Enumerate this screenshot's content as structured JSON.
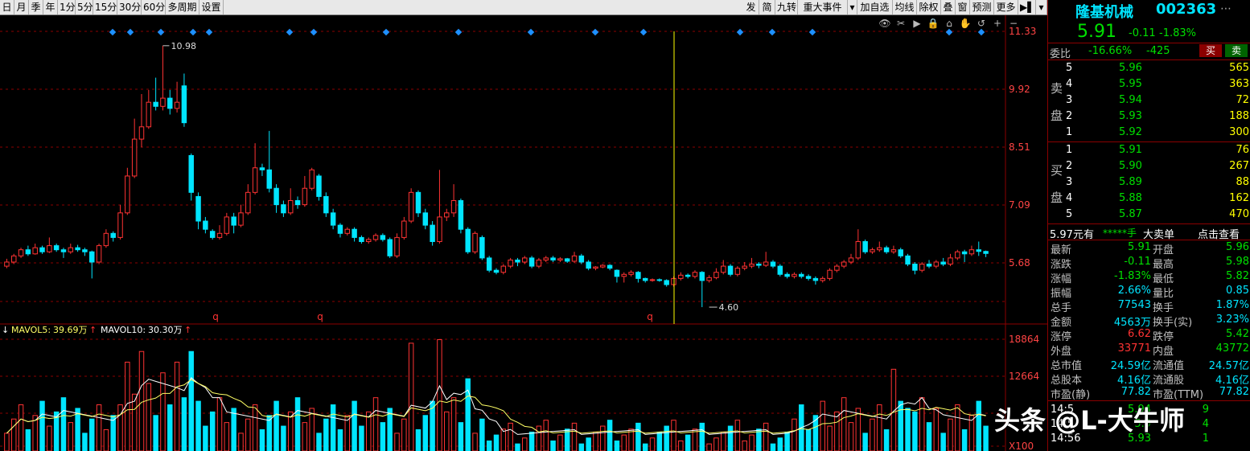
{
  "toolbar": {
    "left_items": [
      "日",
      "月",
      "季",
      "年",
      "1分",
      "5分",
      "15分",
      "30分",
      "60分",
      "多周期",
      "设置"
    ],
    "right_items": [
      "发",
      "简",
      "九转",
      "重大事件",
      "▾",
      "加自选",
      "均线",
      "除权",
      "叠",
      "窗",
      "预测",
      "更多",
      "▶▌",
      "▾"
    ]
  },
  "chart_controls": [
    "eye-icon",
    "scissors-icon",
    "play-icon",
    "lock-icon",
    "home-icon",
    "hand-icon",
    "undo-icon",
    "zoom-in-icon",
    "zoom-out-icon"
  ],
  "price_axis": [
    "11.33",
    "9.92",
    "8.51",
    "7.09",
    "5.68"
  ],
  "volume_axis": [
    "18864",
    "12664",
    "X100"
  ],
  "annotations": {
    "high": "10.98",
    "low": "4.60"
  },
  "markers": [
    "q",
    "q",
    "q"
  ],
  "volume_legend": {
    "mavol5_label": "MAVOL5:",
    "mavol5_value": "39.69万",
    "mavol10_label": "MAVOL10:",
    "mavol10_value": "30.30万"
  },
  "colors": {
    "up": "#ff3333",
    "down": "#00e5ff",
    "ma5": "#ffffff",
    "ma10": "#ffff66",
    "crosshair": "#ffff00",
    "grid": "#8b0000"
  },
  "stock": {
    "name": "隆基机械",
    "code": "002363",
    "price": "5.91",
    "change": "-0.11",
    "change_pct": "-1.83%",
    "weibi_label": "委比",
    "weibi_pct": "-16.66%",
    "weibi_diff": "-425",
    "buy_btn": "买",
    "sell_btn": "卖"
  },
  "sell_side_label": [
    "卖",
    "盘"
  ],
  "buy_side_label": [
    "买",
    "盘"
  ],
  "sell_orders": [
    {
      "level": "5",
      "price": "5.96",
      "vol": "565"
    },
    {
      "level": "4",
      "price": "5.95",
      "vol": "363"
    },
    {
      "level": "3",
      "price": "5.94",
      "vol": "72"
    },
    {
      "level": "2",
      "price": "5.93",
      "vol": "188"
    },
    {
      "level": "1",
      "price": "5.92",
      "vol": "300"
    }
  ],
  "buy_orders": [
    {
      "level": "1",
      "price": "5.91",
      "vol": "76"
    },
    {
      "level": "2",
      "price": "5.90",
      "vol": "267"
    },
    {
      "level": "3",
      "price": "5.89",
      "vol": "88"
    },
    {
      "level": "4",
      "price": "5.88",
      "vol": "162"
    },
    {
      "level": "5",
      "price": "5.87",
      "vol": "470"
    }
  ],
  "bigorder": {
    "price": "5.97元有",
    "stars": "*****手",
    "label": "大卖单",
    "link": "点击查看"
  },
  "quote_rows": [
    {
      "l1": "最新",
      "v1": "5.91",
      "c1": "grn",
      "l2": "开盘",
      "v2": "5.96",
      "c2": "grn"
    },
    {
      "l1": "涨跌",
      "v1": "-0.11",
      "c1": "grn",
      "l2": "最高",
      "v2": "5.98",
      "c2": "grn"
    },
    {
      "l1": "涨幅",
      "v1": "-1.83%",
      "c1": "grn",
      "l2": "最低",
      "v2": "5.82",
      "c2": "grn"
    },
    {
      "l1": "振幅",
      "v1": "2.66%",
      "c1": "cyn",
      "l2": "量比",
      "v2": "0.85",
      "c2": "cyn"
    },
    {
      "l1": "总手",
      "v1": "77543",
      "c1": "cyn",
      "l2": "换手",
      "v2": "1.87%",
      "c2": "cyn"
    },
    {
      "l1": "金额",
      "v1": "4563万",
      "c1": "cyn",
      "l2": "换手(实)",
      "v2": "3.23%",
      "c2": "cyn"
    },
    {
      "l1": "涨停",
      "v1": "6.62",
      "c1": "red",
      "l2": "跌停",
      "v2": "5.42",
      "c2": "grn"
    },
    {
      "l1": "外盘",
      "v1": "33771",
      "c1": "red",
      "l2": "内盘",
      "v2": "43772",
      "c2": "grn"
    },
    {
      "l1": "总市值",
      "v1": "24.59亿",
      "c1": "cyn",
      "l2": "流通值",
      "v2": "24.57亿",
      "c2": "cyn"
    },
    {
      "l1": "总股本",
      "v1": "4.16亿",
      "c1": "cyn",
      "l2": "流通股",
      "v2": "4.16亿",
      "c2": "cyn"
    },
    {
      "l1": "市盈(静)",
      "v1": "77.82",
      "c1": "cyn",
      "l2": "市盈(TTM)",
      "v2": "77.82",
      "c2": "cyn"
    }
  ],
  "trades": [
    {
      "time": "14:5",
      "price": "5.94",
      "vol": "9"
    },
    {
      "time": "14:5",
      "price": "5.9",
      "vol": "4"
    },
    {
      "time": "14:56",
      "price": "5.93",
      "vol": "1"
    }
  ],
  "watermark": "头条 @L-大牛师"
}
